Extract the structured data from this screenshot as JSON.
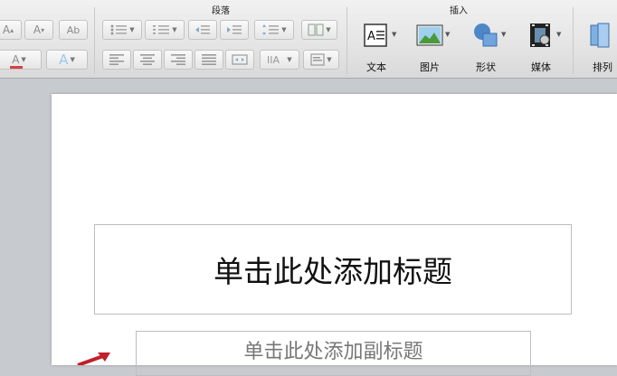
{
  "ribbon": {
    "groups": {
      "paragraph": "段落",
      "insert": "插入"
    },
    "font_buttons": {
      "grow": "A",
      "shrink": "A",
      "color_letter": "A",
      "effect_letter": "A"
    },
    "insert_items": [
      {
        "label": "文本",
        "icon": "text-box-icon"
      },
      {
        "label": "图片",
        "icon": "picture-icon"
      },
      {
        "label": "形状",
        "icon": "shapes-icon"
      },
      {
        "label": "媒体",
        "icon": "media-icon"
      },
      {
        "label": "排列",
        "icon": "arrange-icon"
      }
    ]
  },
  "slide": {
    "title_placeholder": "单击此处添加标题",
    "subtitle_placeholder": "单击此处添加副标题"
  },
  "colors": {
    "font_color_bar": "#d94040",
    "accent_arrow": "#c0202a"
  }
}
